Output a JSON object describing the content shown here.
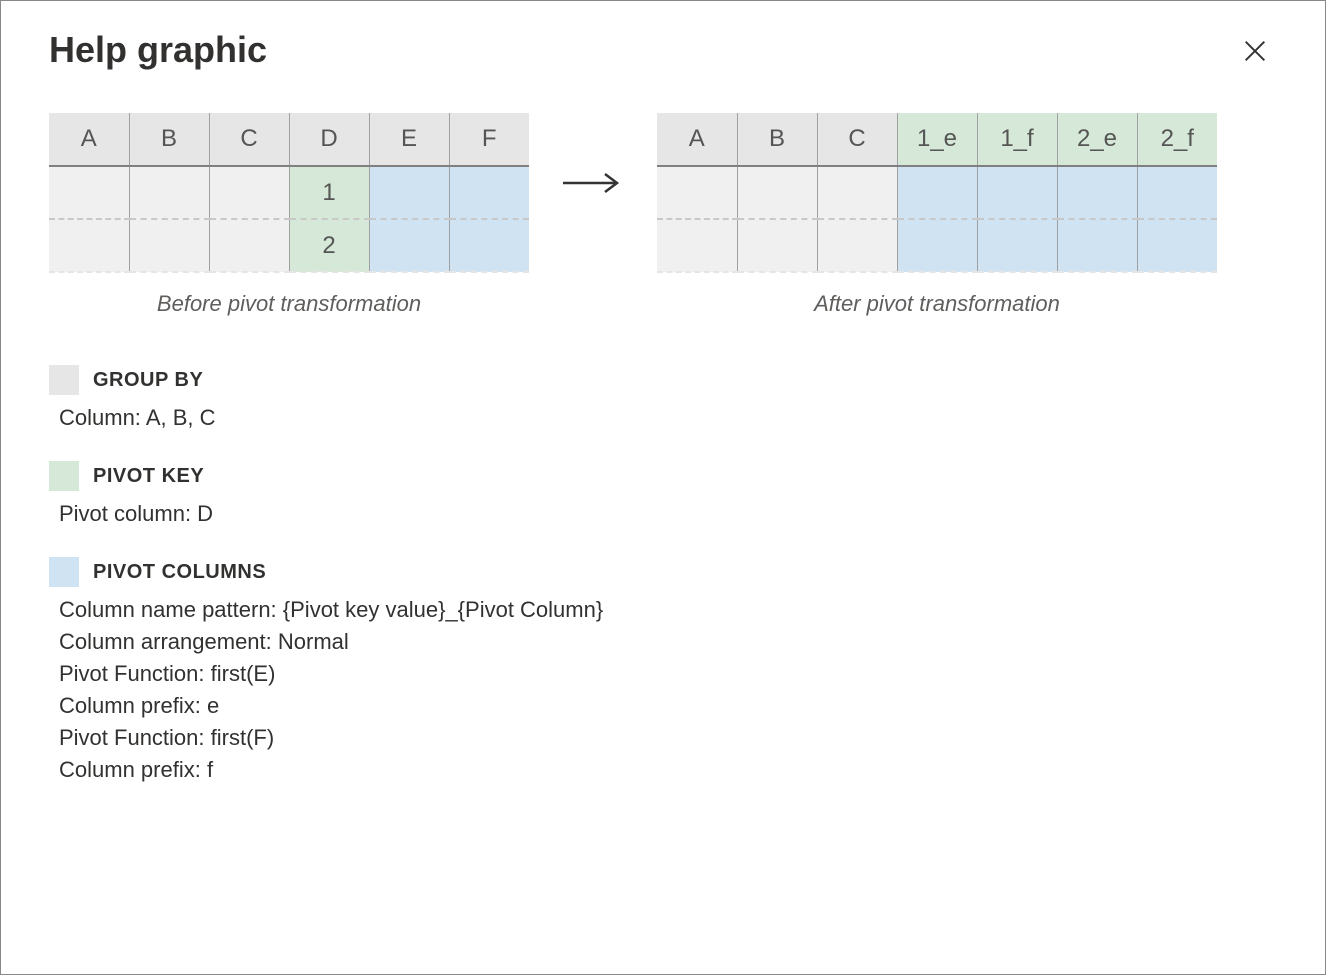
{
  "title": "Help graphic",
  "colors": {
    "grey": "#e6e6e6",
    "green": "#d6e9d8",
    "blue": "#cfe3f2"
  },
  "before": {
    "caption": "Before pivot transformation",
    "headers": [
      {
        "label": "A",
        "tone": "grey"
      },
      {
        "label": "B",
        "tone": "grey"
      },
      {
        "label": "C",
        "tone": "grey"
      },
      {
        "label": "D",
        "tone": "grey"
      },
      {
        "label": "E",
        "tone": "grey"
      },
      {
        "label": "F",
        "tone": "grey"
      }
    ],
    "rows": [
      [
        {
          "label": "",
          "tone": "grey"
        },
        {
          "label": "",
          "tone": "grey"
        },
        {
          "label": "",
          "tone": "grey"
        },
        {
          "label": "1",
          "tone": "green"
        },
        {
          "label": "",
          "tone": "blue"
        },
        {
          "label": "",
          "tone": "blue"
        }
      ],
      [
        {
          "label": "",
          "tone": "grey"
        },
        {
          "label": "",
          "tone": "grey"
        },
        {
          "label": "",
          "tone": "grey"
        },
        {
          "label": "2",
          "tone": "green"
        },
        {
          "label": "",
          "tone": "blue"
        },
        {
          "label": "",
          "tone": "blue"
        }
      ]
    ]
  },
  "after": {
    "caption": "After pivot transformation",
    "headers": [
      {
        "label": "A",
        "tone": "grey"
      },
      {
        "label": "B",
        "tone": "grey"
      },
      {
        "label": "C",
        "tone": "grey"
      },
      {
        "label": "1_e",
        "tone": "green"
      },
      {
        "label": "1_f",
        "tone": "green"
      },
      {
        "label": "2_e",
        "tone": "green"
      },
      {
        "label": "2_f",
        "tone": "green"
      }
    ],
    "rows": [
      [
        {
          "label": "",
          "tone": "grey"
        },
        {
          "label": "",
          "tone": "grey"
        },
        {
          "label": "",
          "tone": "grey"
        },
        {
          "label": "",
          "tone": "blue"
        },
        {
          "label": "",
          "tone": "blue"
        },
        {
          "label": "",
          "tone": "blue"
        },
        {
          "label": "",
          "tone": "blue"
        }
      ],
      [
        {
          "label": "",
          "tone": "grey"
        },
        {
          "label": "",
          "tone": "grey"
        },
        {
          "label": "",
          "tone": "grey"
        },
        {
          "label": "",
          "tone": "blue"
        },
        {
          "label": "",
          "tone": "blue"
        },
        {
          "label": "",
          "tone": "blue"
        },
        {
          "label": "",
          "tone": "blue"
        }
      ]
    ]
  },
  "legend": {
    "groupby": {
      "title": "GROUP BY",
      "lines": [
        "Column: A, B, C"
      ]
    },
    "pivotkey": {
      "title": "PIVOT KEY",
      "lines": [
        "Pivot column: D"
      ]
    },
    "pivotcols": {
      "title": "PIVOT COLUMNS",
      "lines": [
        "Column name pattern:  {Pivot key value}_{Pivot Column}",
        "Column arrangement: Normal",
        "Pivot Function: first(E)",
        "Column prefix: e",
        "Pivot Function: first(F)",
        "Column prefix: f"
      ]
    }
  }
}
